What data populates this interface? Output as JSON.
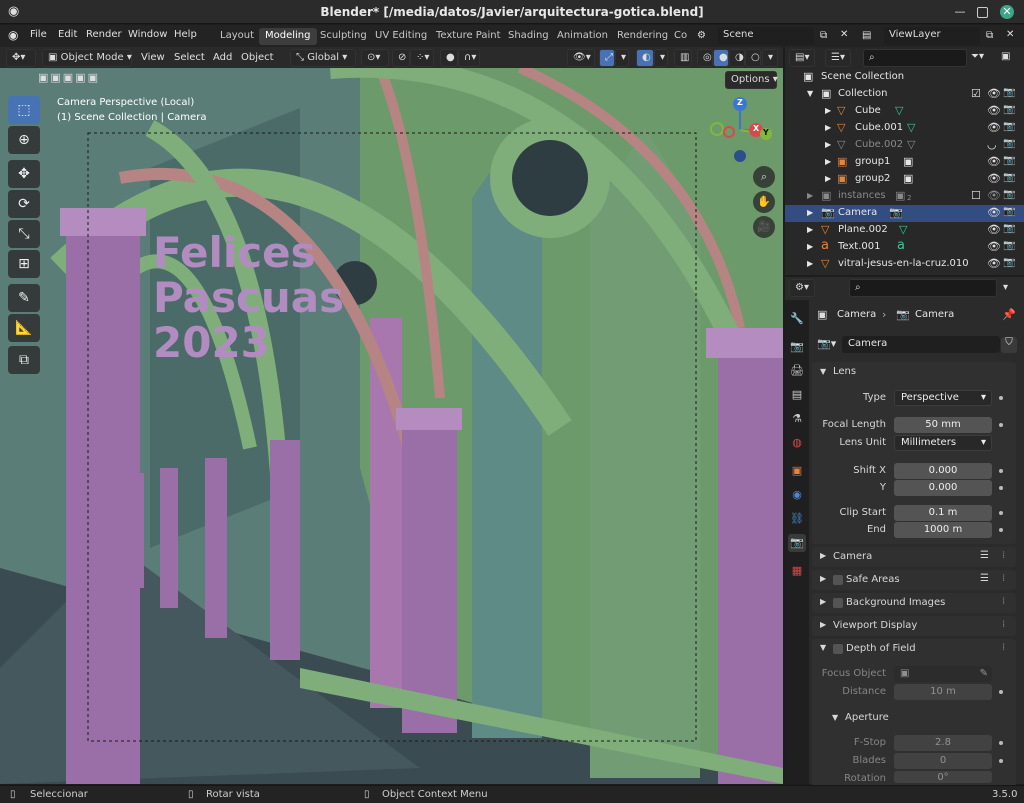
{
  "window": {
    "title": "Blender* [/media/datos/Javier/arquitectura-gotica.blend]"
  },
  "menubar": {
    "menus": [
      "File",
      "Edit",
      "Render",
      "Window",
      "Help"
    ],
    "workspaces": [
      "Layout",
      "Modeling",
      "Sculpting",
      "UV Editing",
      "Texture Paint",
      "Shading",
      "Animation",
      "Rendering",
      "Co"
    ],
    "active_workspace": "Modeling",
    "scene": "Scene",
    "view_layer": "ViewLayer"
  },
  "viewport_header": {
    "mode": "Object Mode",
    "menus": [
      "View",
      "Select",
      "Add",
      "Object"
    ],
    "orientation": "Global",
    "options_label": "Options"
  },
  "viewport": {
    "info_line1": "Camera Perspective (Local)",
    "info_line2": "(1) Scene Collection | Camera",
    "overlay_text_lines": [
      "Felices",
      "Pascuas",
      "2023"
    ],
    "gizmo": {
      "x": "X",
      "y": "Y",
      "z": "Z"
    }
  },
  "outliner": {
    "search_placeholder": "",
    "rows": [
      {
        "label": "Scene Collection",
        "icon": "scene-collection-icon"
      },
      {
        "label": "Collection",
        "icon": "collection-icon"
      },
      {
        "label": "Cube",
        "icon": "mesh-icon"
      },
      {
        "label": "Cube.001",
        "icon": "mesh-icon"
      },
      {
        "label": "Cube.002",
        "icon": "mesh-icon"
      },
      {
        "label": "group1",
        "icon": "instance-icon"
      },
      {
        "label": "group2",
        "icon": "instance-icon"
      },
      {
        "label": "instances",
        "icon": "collection-icon",
        "badge": "2"
      },
      {
        "label": "Camera",
        "icon": "camera-icon"
      },
      {
        "label": "Plane.002",
        "icon": "mesh-icon"
      },
      {
        "label": "Text.001",
        "icon": "text-icon"
      },
      {
        "label": "vitral-jesus-en-la-cruz.010",
        "icon": "mesh-icon"
      }
    ]
  },
  "properties": {
    "breadcrumb_object": "Camera",
    "breadcrumb_data": "Camera",
    "datablock_name": "Camera",
    "lens": {
      "title": "Lens",
      "type_label": "Type",
      "type_value": "Perspective",
      "focal_label": "Focal Length",
      "focal_value": "50 mm",
      "unit_label": "Lens Unit",
      "unit_value": "Millimeters",
      "shiftx_label": "Shift X",
      "shiftx_value": "0.000",
      "shifty_label": "Y",
      "shifty_value": "0.000",
      "clipstart_label": "Clip Start",
      "clipstart_value": "0.1 m",
      "clipend_label": "End",
      "clipend_value": "1000 m"
    },
    "collapsed_panels": [
      "Camera",
      "Safe Areas",
      "Background Images",
      "Viewport Display"
    ],
    "dof": {
      "title": "Depth of Field",
      "focus_object_label": "Focus Object",
      "distance_label": "Distance",
      "distance_value": "10 m",
      "aperture_title": "Aperture",
      "fstop_label": "F-Stop",
      "fstop_value": "2.8",
      "blades_label": "Blades",
      "blades_value": "0",
      "rotation_label": "Rotation",
      "rotation_value": "0°"
    }
  },
  "statusbar": {
    "select": "Seleccionar",
    "rotate": "Rotar vista",
    "context": "Object Context Menu",
    "version": "3.5.0"
  },
  "colors": {
    "accent": "#4772b3",
    "selection": "#334d80",
    "arch_green": "#7fae7a",
    "pillar_purple": "#9a6fa8",
    "rib_pink": "#b78484",
    "text_purple": "#b28cc0"
  }
}
